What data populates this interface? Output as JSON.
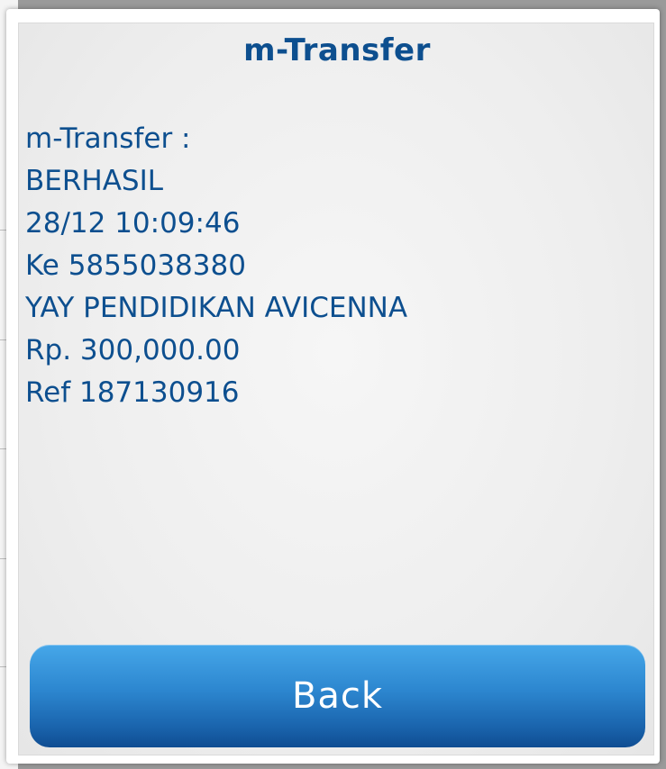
{
  "dialog": {
    "title": "m-Transfer",
    "message_lines": [
      "m-Transfer :",
      "BERHASIL",
      "28/12 10:09:46",
      "Ke 5855038380",
      "YAY PENDIDIKAN AVICENNA",
      "Rp. 300,000.00",
      "Ref 187130916"
    ],
    "back_label": "Back"
  },
  "colors": {
    "text": "#0d4f8f",
    "button_top": "#46a7e9",
    "button_bottom": "#0f4d92",
    "button_text": "#ffffff"
  }
}
